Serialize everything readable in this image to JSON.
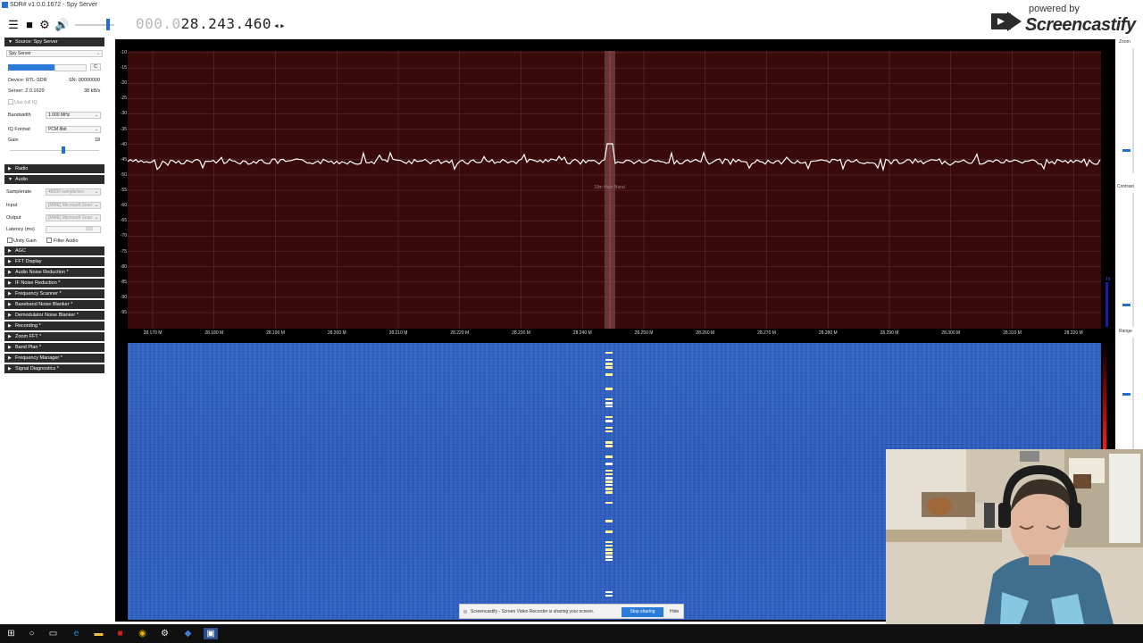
{
  "window": {
    "title": "SDR# v1.0.0.1672 - Spy Server"
  },
  "toolbar": {
    "menu_icon": "hamburger-icon",
    "stop_icon": "stop-icon",
    "settings_icon": "gear-icon",
    "volume_icon": "speaker-icon",
    "freq_dim": "000.0",
    "freq_main": "28.243.460",
    "freq_arrows": "◂▸"
  },
  "watermark": {
    "powered_by": "powered by",
    "brand": "Screencastify"
  },
  "sidebar": {
    "source": {
      "header": "Source: Spy Server",
      "selected": "Spy Server",
      "connect_btn": "C",
      "device_label": "Device: RTL-SDR",
      "serial_label": "SN: 00000000",
      "server_label": "Server: 2.0.1629",
      "rate_label": "38 kB/s",
      "use_full_iq": "Use full IQ",
      "bandwidth_label": "Bandwidth",
      "bandwidth_value": "1.000 MHz",
      "iq_format_label": "IQ Format",
      "iq_format_value": "PCM 8bit",
      "gain_label": "Gain",
      "gain_value": "18"
    },
    "radio_header": "Radio",
    "audio": {
      "header": "Audio",
      "samplerate_label": "Samplerate",
      "samplerate_value": "48000 sample/sec",
      "input_label": "Input",
      "input_value": "[MME] Microsoft Soun",
      "output_label": "Output",
      "output_value": "[MME] Microsoft Soun",
      "latency_label": "Latency (ms)",
      "latency_value": "100",
      "unity_gain": "Unity Gain",
      "filter_audio": "Filter Audio"
    },
    "sections": [
      "AGC",
      "FFT Display",
      "Audio Noise Reduction *",
      "IF Noise Reduction *",
      "Frequency Scanner *",
      "Baseband Noise Blanker *",
      "Demodulator Noise Blanker *",
      "Recording *",
      "Zoom FFT *",
      "Band Plan *",
      "Frequency Manager *",
      "Signal Diagnostics *"
    ]
  },
  "spectrum": {
    "y_ticks": [
      "-10",
      "-15",
      "-20",
      "-25",
      "-30",
      "-35",
      "-40",
      "-45",
      "-50",
      "-55",
      "-60",
      "-65",
      "-70",
      "-75",
      "-80",
      "-85",
      "-90",
      "-95"
    ],
    "x_ticks": [
      "28.170 M",
      "28.180 M",
      "28.190 M",
      "28.200 M",
      "28.210 M",
      "28.220 M",
      "28.230 M",
      "28.240 M",
      "28.250 M",
      "28.260 M",
      "28.270 M",
      "28.280 M",
      "28.290 M",
      "28.300 M",
      "28.310 M",
      "28.320 M"
    ],
    "band_label": "10m Ham Band",
    "colors": {
      "background": "#3a0a0a",
      "grid": "#5a3a3a",
      "trace": "#ffffff",
      "tuned": "#8a5a5a"
    }
  },
  "waterfall": {
    "colors": {
      "base": "#2d60c6",
      "signal": "#fff3a0"
    }
  },
  "rightbar": {
    "zoom_label": "Zoom",
    "contrast_label": "Contrast",
    "range_label": "Range",
    "level_value": "16"
  },
  "share_bar": {
    "message": "Screencastify - Screen Video Recorder is sharing your screen.",
    "stop_label": "Stop sharing",
    "hide_label": "Hide"
  },
  "taskbar": {
    "icons": [
      "windows-start-icon",
      "search-icon",
      "task-view-icon",
      "edge-icon",
      "file-explorer-icon",
      "app-red-icon",
      "chrome-icon",
      "steam-icon",
      "visual-studio-icon",
      "sdr-app-icon"
    ]
  }
}
